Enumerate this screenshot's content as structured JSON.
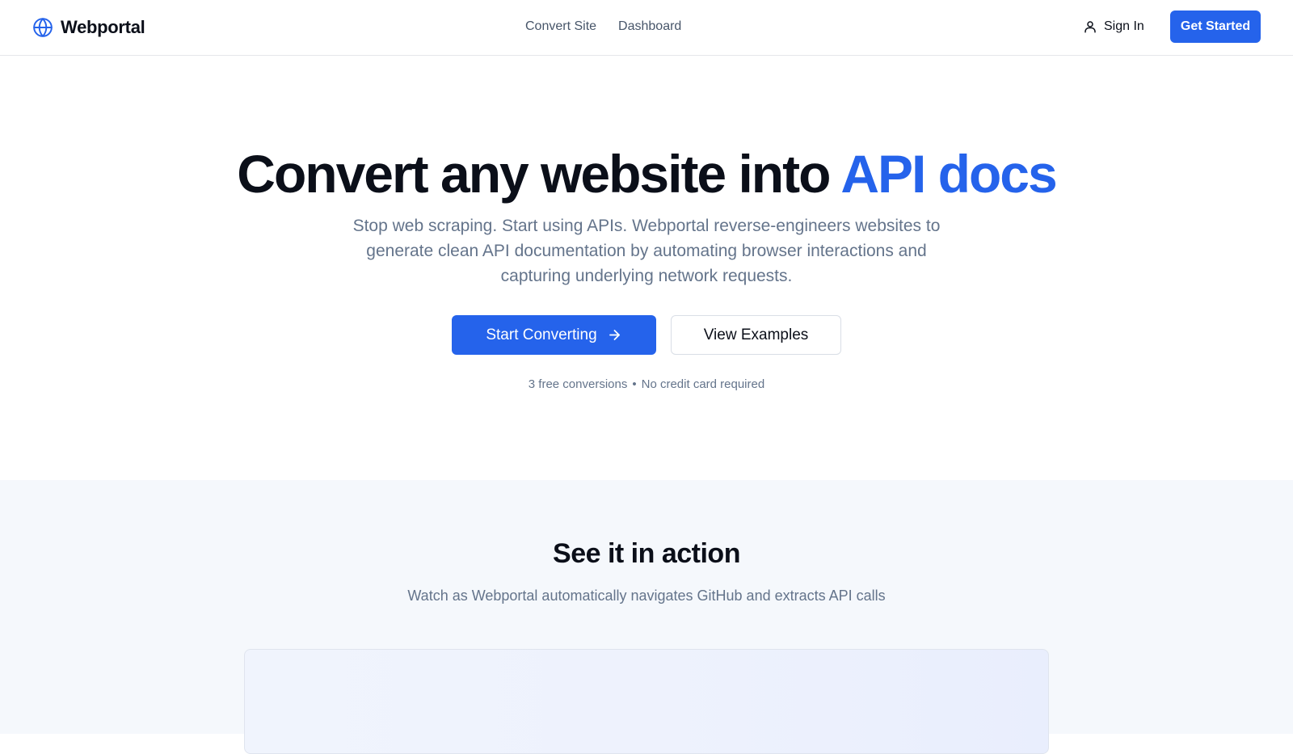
{
  "header": {
    "brand_icon": "globe-icon",
    "brand_name": "Webportal",
    "nav": [
      {
        "label": "Convert Site"
      },
      {
        "label": "Dashboard"
      }
    ],
    "signin_icon": "user-icon",
    "signin_label": "Sign In",
    "get_started_label": "Get Started"
  },
  "hero": {
    "title_main": "Convert any website into ",
    "title_accent": "API docs",
    "subtitle": "Stop web scraping. Start using APIs. Webportal reverse-engineers websites to generate clean API documentation by automating browser interactions and capturing underlying network requests.",
    "primary_cta": "Start Converting",
    "primary_cta_icon": "arrow-right-icon",
    "secondary_cta": "View Examples",
    "fine_print_left": "3 free conversions",
    "fine_print_separator": "•",
    "fine_print_right": "No credit card required"
  },
  "demo": {
    "title": "See it in action",
    "subtitle": "Watch as Webportal automatically navigates GitHub and extracts API calls"
  },
  "colors": {
    "accent": "#2563eb",
    "text_dark": "#0b0f19",
    "text_muted": "#64748b",
    "section_bg": "#f5f8fc"
  }
}
